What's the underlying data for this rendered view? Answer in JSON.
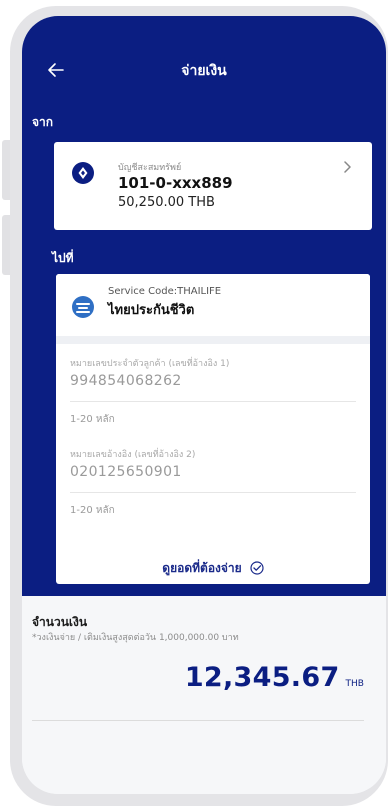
{
  "header": {
    "title": "จ่ายเงิน"
  },
  "from": {
    "label": "จาก",
    "account_type": "บัญชีสะสมทรัพย์",
    "account_number": "101-0-xxx889",
    "balance": "50,250.00 THB"
  },
  "to": {
    "label": "ไปที่",
    "service_code": "Service Code:THAILIFE",
    "service_name": "ไทยประกันชีวิต",
    "fields": [
      {
        "label": "หมายเลขประจำตัวลูกค้า (เลขที่อ้างอิง 1)",
        "value": "994854068262",
        "hint": "1-20 หลัก"
      },
      {
        "label": "หมายเลขอ้างอิง (เลขที่อ้างอิง 2)",
        "value": "020125650901",
        "hint": "1-20 หลัก"
      }
    ],
    "check_amount_label": "ดูยอดที่ต้องจ่าย"
  },
  "amount": {
    "label": "จำนวนเงิน",
    "note": "*วงเงินจ่าย / เติมเงินสูงสุดต่อวัน 1,000,000.00 บาท",
    "value": "12,345.67",
    "currency": "THB"
  },
  "colors": {
    "primary": "#0b1e82",
    "surface": "#ffffff",
    "background": "#f6f7f9"
  },
  "icons": {
    "back": "arrow-left-icon",
    "account": "coin-icon",
    "chevron": "chevron-right-icon",
    "payee_logo": "thailife-logo-icon",
    "check": "check-circle-icon"
  }
}
